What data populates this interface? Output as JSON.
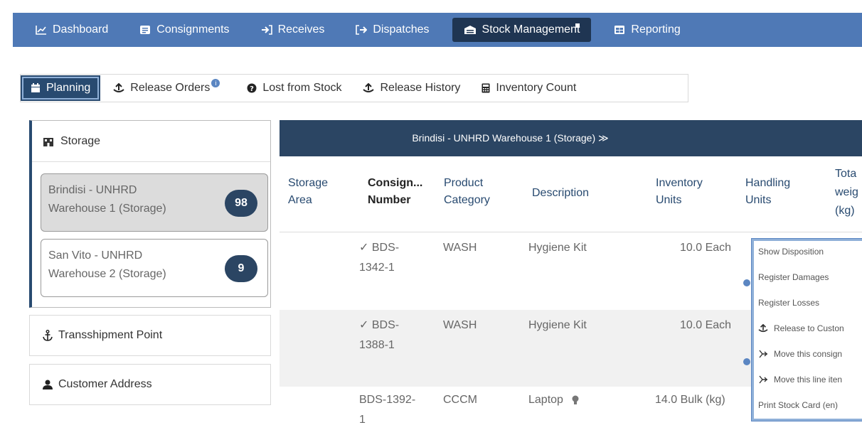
{
  "topnav": {
    "items": [
      {
        "label": "Dashboard",
        "icon": "chart-line-icon"
      },
      {
        "label": "Consignments",
        "icon": "list-box-icon"
      },
      {
        "label": "Receives",
        "icon": "sign-in-icon"
      },
      {
        "label": "Dispatches",
        "icon": "sign-out-icon"
      },
      {
        "label": "Stock Management",
        "icon": "warehouse-icon",
        "active": true
      },
      {
        "label": "Reporting",
        "icon": "table-icon"
      }
    ]
  },
  "subtabs": [
    {
      "label": "Planning",
      "icon": "calendar-icon",
      "active": true
    },
    {
      "label": "Release Orders",
      "icon": "release-icon",
      "badge": "i"
    },
    {
      "label": "Lost from Stock",
      "icon": "question-circle-icon"
    },
    {
      "label": "Release History",
      "icon": "release-icon"
    },
    {
      "label": "Inventory Count",
      "icon": "calculator-icon"
    }
  ],
  "left": {
    "storage_label": "Storage",
    "warehouses": [
      {
        "name_line1": "Brindisi - UNHRD",
        "name_line2": "Warehouse 1 (Storage)",
        "count": "98"
      },
      {
        "name_line1": "San Vito - UNHRD",
        "name_line2": "Warehouse 2 (Storage)",
        "count": "9"
      }
    ],
    "transshipment_label": "Transshipment Point",
    "customer_label": "Customer Address"
  },
  "main": {
    "title": "Brindisi - UNHRD Warehouse 1 (Storage) ≫",
    "columns": [
      {
        "line1": "Storage",
        "line2": "Area",
        "line3": ""
      },
      {
        "line1": "Consign...",
        "line2": "Number",
        "line3": ""
      },
      {
        "line1": "Product",
        "line2": "Category",
        "line3": ""
      },
      {
        "line1": "Description",
        "line2": "",
        "line3": ""
      },
      {
        "line1": "Inventory",
        "line2": "Units",
        "line3": ""
      },
      {
        "line1": "Handling",
        "line2": "Units",
        "line3": ""
      },
      {
        "line1": "Tota",
        "line2": "weig",
        "line3": "(kg)"
      }
    ],
    "rows": [
      {
        "cons1": "✓ BDS-",
        "cons2": "1342-1",
        "category": "WASH",
        "description": "Hygiene Kit",
        "inventory": "10.0 Each"
      },
      {
        "cons1": "✓ BDS-",
        "cons2": "1388-1",
        "category": "WASH",
        "description": "Hygiene Kit",
        "inventory": "10.0 Each"
      },
      {
        "cons1": "BDS-1392-",
        "cons2": "1",
        "category": "CCCM",
        "description": "Laptop",
        "inventory": "14.0 Bulk (kg)"
      }
    ]
  },
  "context_menu": {
    "items": [
      {
        "label": "Show Disposition",
        "icon": ""
      },
      {
        "label": "Register Damages",
        "icon": ""
      },
      {
        "label": "Register Losses",
        "icon": ""
      },
      {
        "label": "Release to Custon",
        "icon": "release-icon"
      },
      {
        "label": "Move this consign",
        "icon": "move-icon"
      },
      {
        "label": "Move this line iten",
        "icon": "move-icon"
      },
      {
        "label": "Print Stock Card (en)",
        "icon": ""
      }
    ]
  },
  "colors": {
    "nav_bg": "#4f79b6",
    "nav_active": "#1f3552",
    "dark_blue": "#2b4563",
    "accent": "#5b86c2"
  }
}
